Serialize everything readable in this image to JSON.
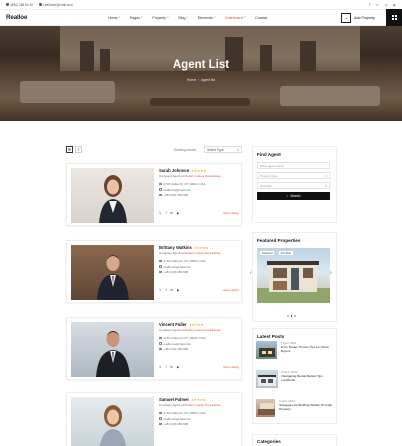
{
  "topbar": {
    "phone": "(880) 256 54 40",
    "email": "realhome@mail.com"
  },
  "logo": "Realloe",
  "nav": [
    {
      "label": "Home",
      "active": false
    },
    {
      "label": "Pages",
      "active": false
    },
    {
      "label": "Property",
      "active": false
    },
    {
      "label": "Blog",
      "active": false
    },
    {
      "label": "Elements",
      "active": false
    },
    {
      "label": "Dashboard",
      "active": true
    },
    {
      "label": "Contact",
      "active": false
    }
  ],
  "add_property": "Add Property",
  "hero": {
    "title": "Agent List",
    "breadcrumb_home": "Home",
    "breadcrumb_current": "Agent list"
  },
  "toolbar": {
    "sort_label": "Showing results",
    "select_placeholder": "Select Type"
  },
  "agents": [
    {
      "name": "Sarah Johnson",
      "stars": "★★★★★",
      "company_prefix": "Company Agent at",
      "company": "Modern House Real Estate",
      "address": "2715 Aruba Dr, NY 10022, USA",
      "email": "realhome@mail.com",
      "phone": "+48 (123) 456 999",
      "view": "View Listing"
    },
    {
      "name": "Brittany Watkins",
      "stars": "★★★★★",
      "company_prefix": "Company Agent at",
      "company": "Modern House Real Estate",
      "address": "2715 Aruba Dr, NY 10022, USA",
      "email": "realhome@mail.com",
      "phone": "+48 (123) 456 999",
      "view": "View Listing"
    },
    {
      "name": "Vincent Fuller",
      "stars": "★★★★★",
      "company_prefix": "Company Agent at",
      "company": "Modern House Real Estate",
      "address": "2715 Aruba Dr, NY 10022, USA",
      "email": "realhome@mail.com",
      "phone": "+48 (123) 456 999",
      "view": "View Listing"
    },
    {
      "name": "Samuel Palmer",
      "stars": "★★★★★",
      "company_prefix": "Company Agent at",
      "company": "Modern House Real Estate",
      "address": "2715 Aruba Dr, NY 10022, USA",
      "email": "realhome@mail.com",
      "phone": "+48 (123) 456 999",
      "view": "View Listing"
    }
  ],
  "find_agent": {
    "title": "Find Agent",
    "name_placeholder": "Enter agent name",
    "type_placeholder": "Property type",
    "city_placeholder": "All Cities",
    "search": "Search"
  },
  "featured": {
    "title": "Featured Properties",
    "badge1": "Featured",
    "badge2": "For Rent"
  },
  "latest_posts": {
    "title": "Latest Posts",
    "posts": [
      {
        "date": "6 April, 2023",
        "title": "From Dream Homes Tips for Home Buyers"
      },
      {
        "date": "6 April, 2023",
        "title": "Navigating Rental Market Tips Landlords"
      },
      {
        "date": "6 April, 2023",
        "title": "Strategies for Building Wealth Through Property"
      }
    ]
  },
  "categories_title": "Categories",
  "colors": {
    "accent": "#e34b3c",
    "star": "#f5a623",
    "dark": "#111111"
  }
}
